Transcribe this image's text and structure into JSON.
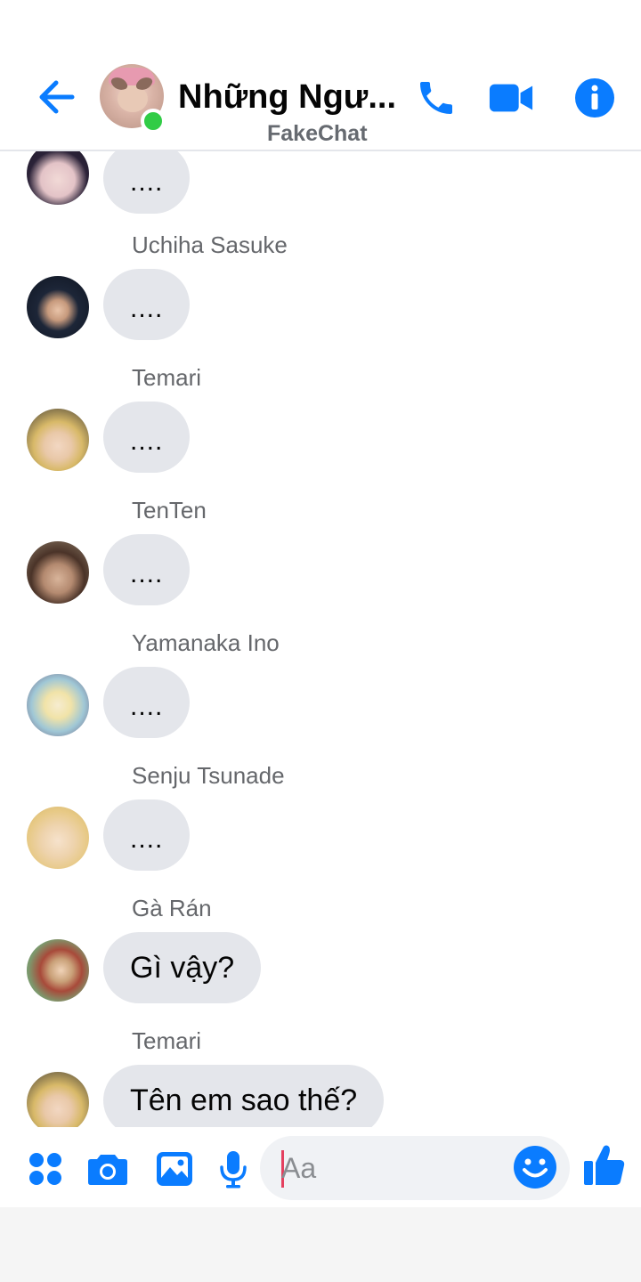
{
  "header": {
    "back_icon": "arrow-left-icon",
    "title": "Những Ngư...",
    "subtitle": "FakeChat",
    "online": true,
    "call_icon": "phone-icon",
    "video_icon": "video-camera-icon",
    "info_icon": "info-icon"
  },
  "messages": [
    {
      "sender": "",
      "text": "...."
    },
    {
      "sender": "Uchiha Sasuke",
      "text": "...."
    },
    {
      "sender": "Temari",
      "text": "...."
    },
    {
      "sender": "TenTen",
      "text": "...."
    },
    {
      "sender": "Yamanaka Ino",
      "text": "...."
    },
    {
      "sender": "Senju Tsunade",
      "text": "...."
    },
    {
      "sender": "Gà Rán",
      "text": "Gì vậy?"
    },
    {
      "sender": "Temari",
      "text": "Tên em sao thế?"
    }
  ],
  "composer": {
    "placeholder": "Aa",
    "icons": [
      "apps-grid-icon",
      "camera-icon",
      "photo-icon",
      "microphone-icon",
      "emoji-icon",
      "thumbs-up-icon"
    ]
  },
  "colors": {
    "accent": "#0a7cff",
    "bubble": "#e4e6eb",
    "online": "#31cc46",
    "caret": "#e4405f"
  }
}
